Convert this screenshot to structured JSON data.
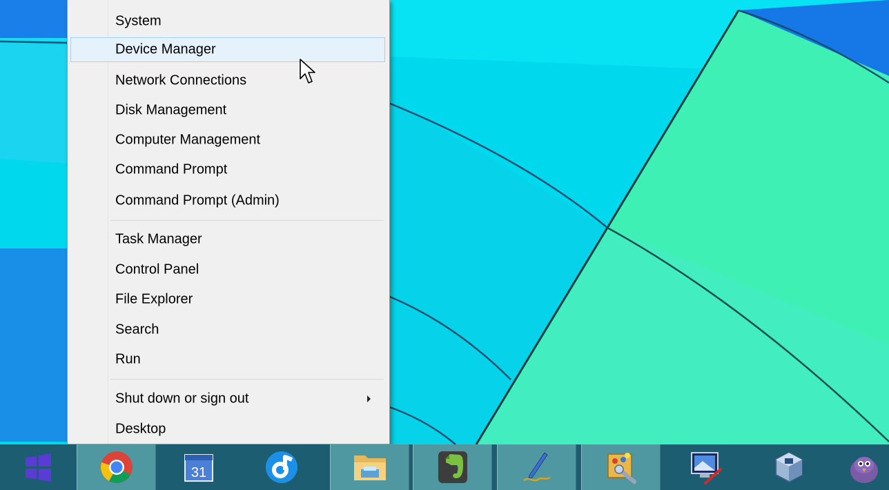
{
  "menu": {
    "hovered": "Device Manager",
    "groups": [
      [
        "System",
        "Device Manager",
        "Network Connections",
        "Disk Management",
        "Computer Management",
        "Command Prompt",
        "Command Prompt (Admin)"
      ],
      [
        "Task Manager",
        "Control Panel",
        "File Explorer",
        "Search",
        "Run"
      ],
      [
        "Shut down or sign out",
        "Desktop"
      ]
    ],
    "submenu_items": [
      "Shut down or sign out"
    ]
  },
  "taskbar": {
    "start_icon": "windows-logo-icon",
    "items": [
      {
        "icon": "chrome-icon",
        "active": true
      },
      {
        "icon": "calendar-icon",
        "label": "31",
        "active": false
      },
      {
        "icon": "rdio-icon",
        "active": false
      },
      {
        "icon": "file-explorer-icon",
        "active": true
      },
      {
        "icon": "evernote-icon",
        "active": true
      },
      {
        "icon": "pen-app-icon",
        "active": true
      },
      {
        "icon": "paint-app-icon",
        "active": true
      },
      {
        "icon": "remote-desktop-icon",
        "active": false
      },
      {
        "icon": "virtualbox-icon",
        "active": false
      },
      {
        "icon": "pidgin-icon",
        "active": false
      }
    ]
  },
  "colors": {
    "wallpaper_blue": "#00d2e6",
    "wallpaper_green": "#2ff0b5",
    "taskbar": "#1d5d72",
    "start": "#5b3bd6",
    "menu_hover": "#e5f1fb"
  }
}
